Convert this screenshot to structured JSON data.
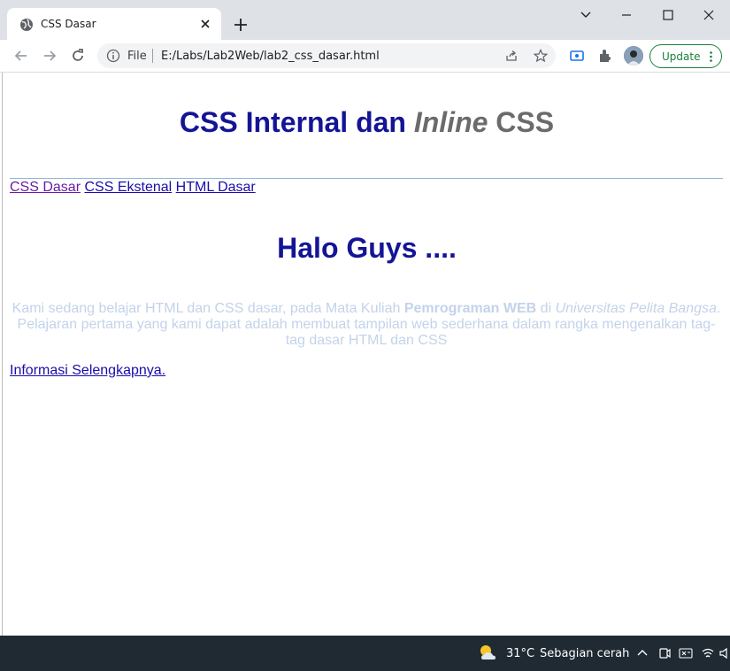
{
  "browser": {
    "tab": {
      "title": "CSS Dasar"
    },
    "omnibox": {
      "scheme_label": "File",
      "url": "E:/Labs/Lab2Web/lab2_css_dasar.html"
    },
    "update_label": "Update"
  },
  "page": {
    "heading": {
      "part1": "CSS Internal dan ",
      "italic": "Inline",
      "part2": " CSS"
    },
    "nav": [
      {
        "label": "CSS Dasar",
        "visited": true
      },
      {
        "label": "CSS Ekstenal",
        "visited": false
      },
      {
        "label": "HTML Dasar",
        "visited": false
      }
    ],
    "subheading": "Halo Guys ....",
    "paragraph": {
      "text1": "Kami sedang belajar HTML dan CSS dasar, pada Mata Kuliah ",
      "bold": "Pemrograman WEB",
      "text2": " di ",
      "italic": "Universitas Pelita Bangsa",
      "text3": ". Pelajaran pertama yang kami dapat adalah membuat tampilan web sederhana dalam rangka mengenalkan tag-tag dasar HTML dan CSS"
    },
    "more_link": "Informasi Selengkapnya."
  },
  "taskbar": {
    "temperature": "31°C",
    "weather": "Sebagian cerah"
  },
  "colors": {
    "heading": "#141496",
    "inline": "#6b6b6b",
    "paragraph": "#c3d3ea",
    "link": "#1a0dab",
    "visited": "#681da8",
    "accent": "#188038"
  }
}
